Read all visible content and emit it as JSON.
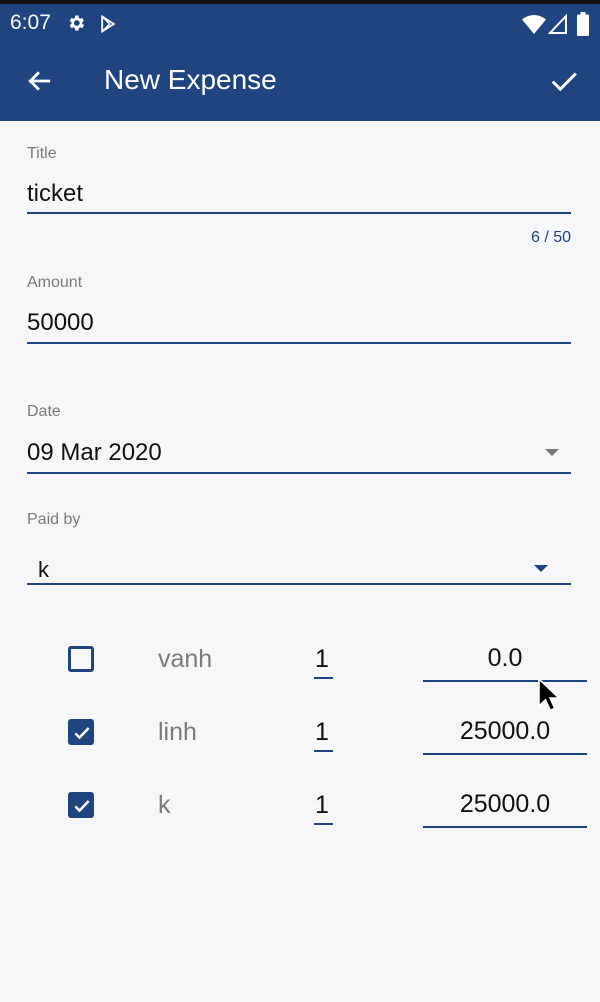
{
  "status_bar": {
    "time": "6:07"
  },
  "app_bar": {
    "title": "New Expense"
  },
  "form": {
    "title_label": "Title",
    "title_value": "ticket",
    "title_counter": "6 / 50",
    "amount_label": "Amount",
    "amount_value": "50000",
    "date_label": "Date",
    "date_value": "09 Mar 2020",
    "paid_by_label": "Paid by",
    "paid_by_value": "k"
  },
  "members": [
    {
      "name": "vanh",
      "checked": false,
      "share": "1",
      "amount": "0.0"
    },
    {
      "name": "linh",
      "checked": true,
      "share": "1",
      "amount": "25000.0"
    },
    {
      "name": "k",
      "checked": true,
      "share": "1",
      "amount": "25000.0"
    }
  ],
  "colors": {
    "primary": "#1f4480",
    "background": "#f7f7f9",
    "label": "#7a7a7a"
  },
  "icons": [
    "gear-icon",
    "play-store-icon",
    "wifi-icon",
    "signal-icon",
    "battery-icon",
    "back-arrow-icon",
    "check-icon",
    "dropdown-arrow-icon",
    "cursor-icon"
  ]
}
